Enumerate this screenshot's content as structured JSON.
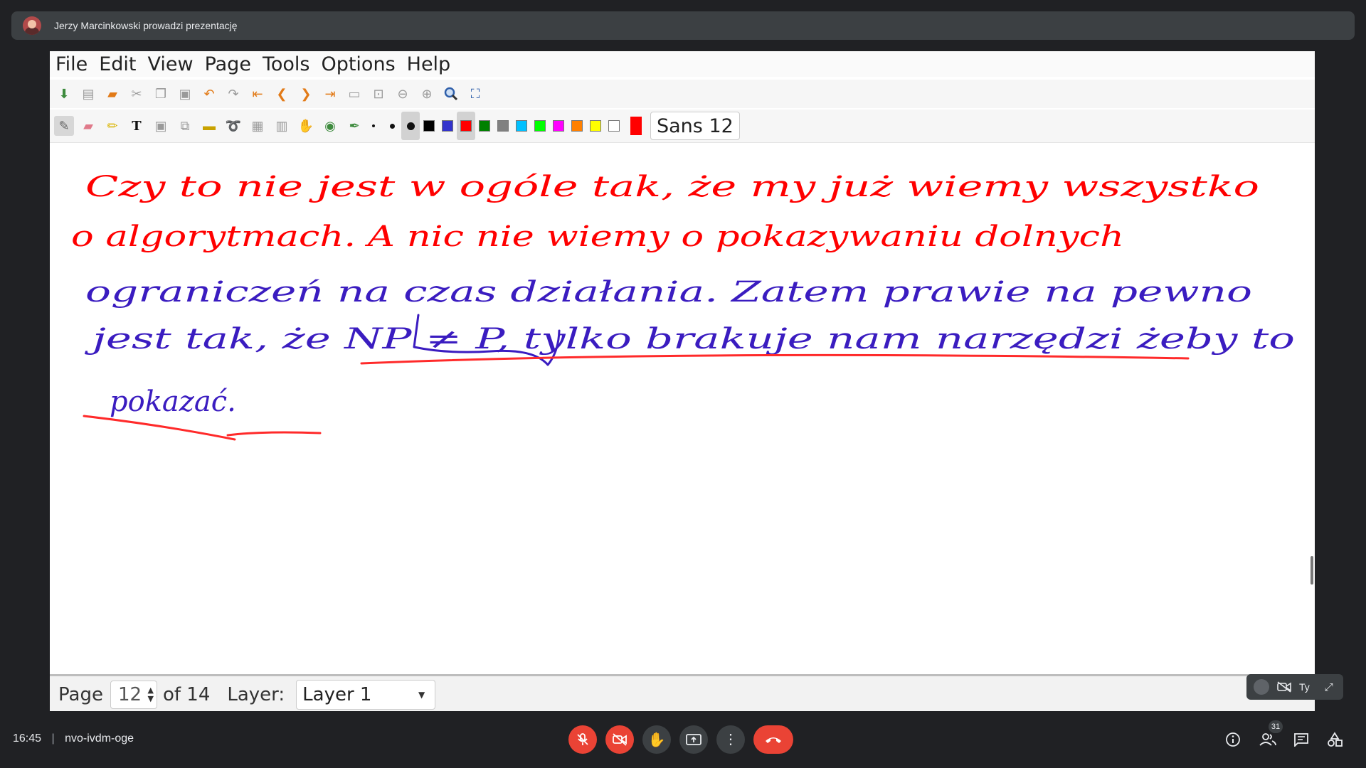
{
  "banner": {
    "presenter_text": "Jerzy Marcinkowski prowadzi prezentację"
  },
  "app": {
    "menu": [
      "File",
      "Edit",
      "View",
      "Page",
      "Tools",
      "Options",
      "Help"
    ],
    "font_button": "Sans 12",
    "palette": [
      "#000000",
      "#3333cc",
      "#ff0000",
      "#008000",
      "#808080",
      "#00c0ff",
      "#00ff00",
      "#ff00ff",
      "#ff8000",
      "#ffff00",
      "#ffffff"
    ],
    "selected_color": "#ff0000",
    "page_label": "Page",
    "page_number": "12",
    "page_total": "of 14",
    "layer_label": "Layer:",
    "layer_value": "Layer 1"
  },
  "handwriting": {
    "line1": "Czy to nie jest w ogóle tak, że my już wiemy wszystko",
    "line2": "o algorytmach. A nic nie wiemy o pokazywaniu dolnych",
    "line3": "ograniczeń na czas działania. Zatem prawie na pewno",
    "line4": "jest tak, że NP ≠ P, tylko brakuje nam narzędzi żeby to",
    "line5": "pokazać."
  },
  "self_view": {
    "name": "Ty"
  },
  "bottom_bar": {
    "time": "16:45",
    "separator": "|",
    "meeting_code": "nvo-ivdm-oge",
    "participants_count": "31"
  }
}
